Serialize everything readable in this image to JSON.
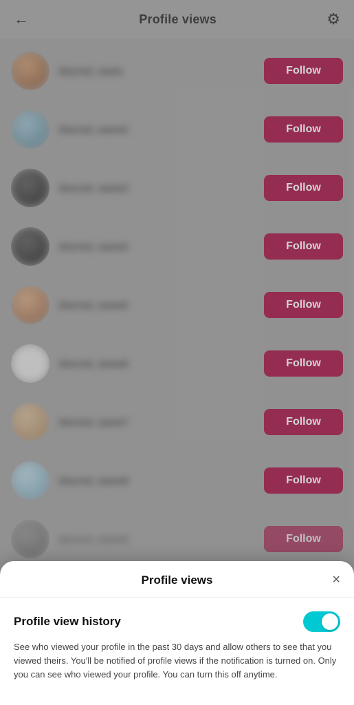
{
  "header": {
    "title": "Profile views",
    "back_label": "←",
    "gear_label": "⚙"
  },
  "users": [
    {
      "id": 1,
      "username": "abc",
      "avatar_class": "avatar-person1",
      "follow_label": "Follow"
    },
    {
      "id": 2,
      "username": "username2",
      "avatar_class": "avatar-person2",
      "follow_label": "Follow"
    },
    {
      "id": 3,
      "username": "username3",
      "avatar_class": "avatar-dark",
      "follow_label": "Follow"
    },
    {
      "id": 4,
      "username": "username4",
      "avatar_class": "avatar-dark",
      "follow_label": "Follow"
    },
    {
      "id": 5,
      "username": "username5",
      "avatar_class": "avatar-person3",
      "follow_label": "Follow"
    },
    {
      "id": 6,
      "username": "user",
      "avatar_class": "avatar-white",
      "follow_label": "Follow"
    },
    {
      "id": 7,
      "username": "user7",
      "avatar_class": "avatar-tan",
      "follow_label": "Follow"
    },
    {
      "id": 8,
      "username": "username8",
      "avatar_class": "avatar-person4",
      "follow_label": "Follow"
    },
    {
      "id": 9,
      "username": "username9",
      "avatar_class": "avatar-medium",
      "follow_label": "Follow"
    }
  ],
  "bottom_sheet": {
    "title": "Profile views",
    "close_label": "×",
    "toggle_label": "Profile view history",
    "toggle_on": true,
    "description": "See who viewed your profile in the past 30 days and allow others to see that you viewed theirs. You'll be notified of profile views if the notification is turned on. Only you can see who viewed your profile. You can turn this off anytime."
  },
  "colors": {
    "follow_btn_bg": "#a0003a",
    "toggle_bg": "#00c9d4"
  }
}
